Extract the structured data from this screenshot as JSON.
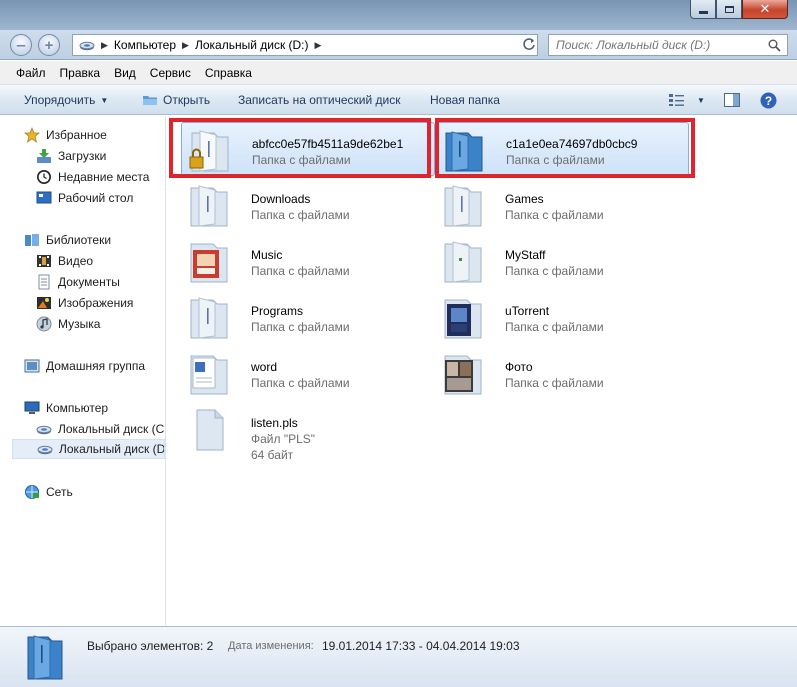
{
  "window": {
    "controls": {
      "minimize": "",
      "maximize": "",
      "close": "✕"
    }
  },
  "address": {
    "crumbs": [
      "Компьютер",
      "Локальный диск (D:)"
    ],
    "search_placeholder": "Поиск: Локальный диск (D:)"
  },
  "menu": [
    "Файл",
    "Правка",
    "Вид",
    "Сервис",
    "Справка"
  ],
  "toolbar": {
    "organize": "Упорядочить",
    "open": "Открыть",
    "burn": "Записать на оптический диск",
    "new_folder": "Новая папка"
  },
  "nav": {
    "favorites": "Избранное",
    "downloads": "Загрузки",
    "recent": "Недавние места",
    "desktop": "Рабочий стол",
    "libraries": "Библиотеки",
    "video": "Видео",
    "documents": "Документы",
    "images": "Изображения",
    "music": "Музыка",
    "homegroup": "Домашняя группа",
    "computer": "Компьютер",
    "disk_c": "Локальный диск (C:)",
    "disk_d": "Локальный диск (D:)",
    "network": "Сеть"
  },
  "files": [
    {
      "name": "abfcc0e57fb4511a9de62be1",
      "type": "Папка с файлами",
      "icon": "locked-folder-icon",
      "selected": true
    },
    {
      "name": "c1a1e0ea74697db0cbc9",
      "type": "Папка с файлами",
      "icon": "blue-folder-icon",
      "selected": true
    },
    {
      "name": "Downloads",
      "type": "Папка с файлами",
      "icon": "folder-icon",
      "selected": false
    },
    {
      "name": "Games",
      "type": "Папка с файлами",
      "icon": "folder-icon",
      "selected": false
    },
    {
      "name": "Music",
      "type": "Папка с файлами",
      "icon": "music-folder-icon",
      "selected": false
    },
    {
      "name": "MyStaff",
      "type": "Папка с файлами",
      "icon": "folder-icon",
      "selected": false
    },
    {
      "name": "Programs",
      "type": "Папка с файлами",
      "icon": "folder-icon",
      "selected": false
    },
    {
      "name": "uTorrent",
      "type": "Папка с файлами",
      "icon": "media-folder-icon",
      "selected": false
    },
    {
      "name": "word",
      "type": "Папка с файлами",
      "icon": "word-folder-icon",
      "selected": false
    },
    {
      "name": "Фото",
      "type": "Папка с файлами",
      "icon": "photo-folder-icon",
      "selected": false
    },
    {
      "name": "listen.pls",
      "type": "Файл \"PLS\"",
      "size": "64 байт",
      "icon": "file-icon",
      "selected": false
    }
  ],
  "details": {
    "count": "Выбрано элементов: 2",
    "date_label": "Дата изменения:",
    "date_value": "19.01.2014 17:33 - 04.04.2014 19:03"
  },
  "colors": {
    "highlight_box": "#e0242c",
    "selection": "#cde2f8"
  }
}
